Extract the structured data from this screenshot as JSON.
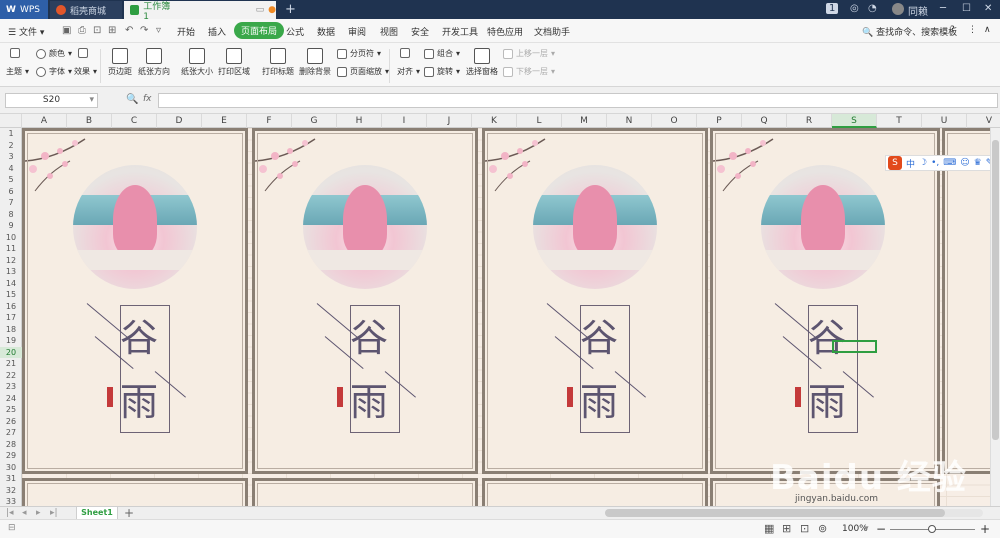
{
  "titlebar": {
    "tabs": [
      {
        "label": "WPS"
      },
      {
        "label": "稻壳商城"
      },
      {
        "label": "工作簿1"
      }
    ],
    "right": {
      "page_badge": "1",
      "user": "同赖"
    }
  },
  "menubar": {
    "file_label": "文件",
    "items": [
      "开始",
      "插入",
      "页面布局",
      "公式",
      "数据",
      "审阅",
      "视图",
      "安全",
      "开发工具",
      "特色应用",
      "文档助手"
    ],
    "active": "页面布局",
    "search_label": "查找命令、搜索模板",
    "help": "?"
  },
  "ribbon": {
    "theme": "主题",
    "color": "颜色",
    "font": "字体",
    "effect": "效果",
    "margins": "页边距",
    "orientation": "纸张方向",
    "size": "纸张大小",
    "print_area": "打印区域",
    "print_titles": "打印标题",
    "delete_bg": "删除背景",
    "page_break": "分页符",
    "page_zoom": "页面缩放",
    "align": "对齐",
    "group": "组合",
    "rotate": "旋转",
    "selection_pane": "选择窗格",
    "bring_forward": "上移一层",
    "send_backward": "下移一层"
  },
  "formula_bar": {
    "cell_ref": "S20",
    "fx": "fx",
    "value": ""
  },
  "columns": [
    "A",
    "B",
    "C",
    "D",
    "E",
    "F",
    "G",
    "H",
    "I",
    "J",
    "K",
    "L",
    "M",
    "N",
    "O",
    "P",
    "Q",
    "R",
    "S",
    "T",
    "U",
    "V"
  ],
  "selected_column": "S",
  "rows": [
    "1",
    "2",
    "3",
    "4",
    "5",
    "6",
    "7",
    "8",
    "9",
    "10",
    "11",
    "12",
    "13",
    "14",
    "15",
    "16",
    "17",
    "18",
    "19",
    "20",
    "21",
    "22",
    "23",
    "24",
    "25",
    "26",
    "27",
    "28",
    "29",
    "30",
    "31",
    "32",
    "33"
  ],
  "selected_row": "20",
  "cards": [
    {
      "char_top": "谷",
      "char_bottom": "雨"
    },
    {
      "char_top": "谷",
      "char_bottom": "雨"
    },
    {
      "char_top": "谷",
      "char_bottom": "雨"
    },
    {
      "char_top": "谷",
      "char_bottom": "雨"
    }
  ],
  "ime_toolbar": {
    "logo": "S",
    "mode": "中"
  },
  "sheetbar": {
    "tab": "Sheet1",
    "add": "+"
  },
  "statusbar": {
    "zoom": "100%",
    "minus": "−",
    "plus": "+"
  },
  "watermark": {
    "text": "Baidu 经验",
    "url": "jingyan.baidu.com"
  },
  "colors": {
    "accent": "#3aa84a",
    "titlebar": "#1f3350",
    "card_border": "#8a7f74"
  }
}
